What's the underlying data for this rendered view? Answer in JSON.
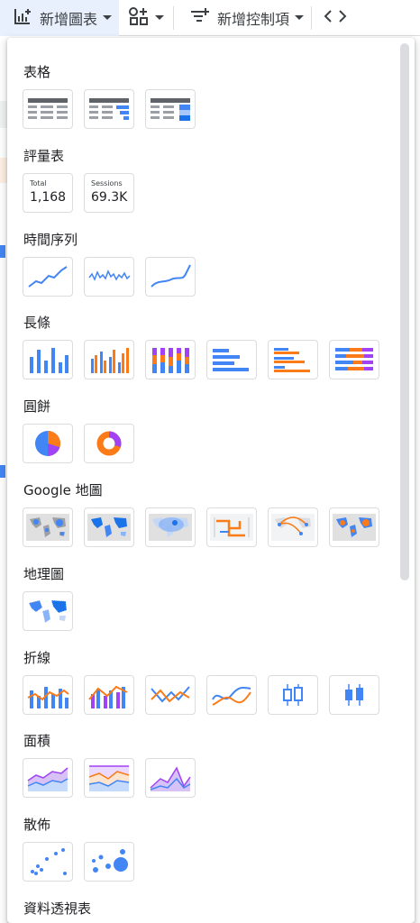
{
  "toolbar": {
    "add_chart_label": "新增圖表",
    "add_control_label": "新增控制項",
    "icons": [
      "add-chart-icon",
      "community-viz-icon",
      "add-control-icon",
      "embed-code-icon"
    ]
  },
  "menu": {
    "sections": {
      "table": {
        "title": "表格"
      },
      "scorecard": {
        "title": "評量表"
      },
      "timeseries": {
        "title": "時間序列"
      },
      "bar": {
        "title": "長條"
      },
      "pie": {
        "title": "圓餅"
      },
      "googlemaps": {
        "title": "Google 地圖"
      },
      "geo": {
        "title": "地理圖"
      },
      "combo": {
        "title": "折線"
      },
      "area": {
        "title": "面積"
      },
      "scatter": {
        "title": "散佈"
      },
      "pivot": {
        "title": "資料透視表"
      }
    },
    "scorecards": [
      {
        "label": "Total",
        "value": "1,168"
      },
      {
        "label": "Sessions",
        "value": "69.3K"
      }
    ]
  },
  "colors": {
    "blue": "#4285f4",
    "orange": "#fa7b17",
    "purple": "#a142f4",
    "panel_border": "#dadce0",
    "toolbar_active": "#e8f0fe"
  }
}
